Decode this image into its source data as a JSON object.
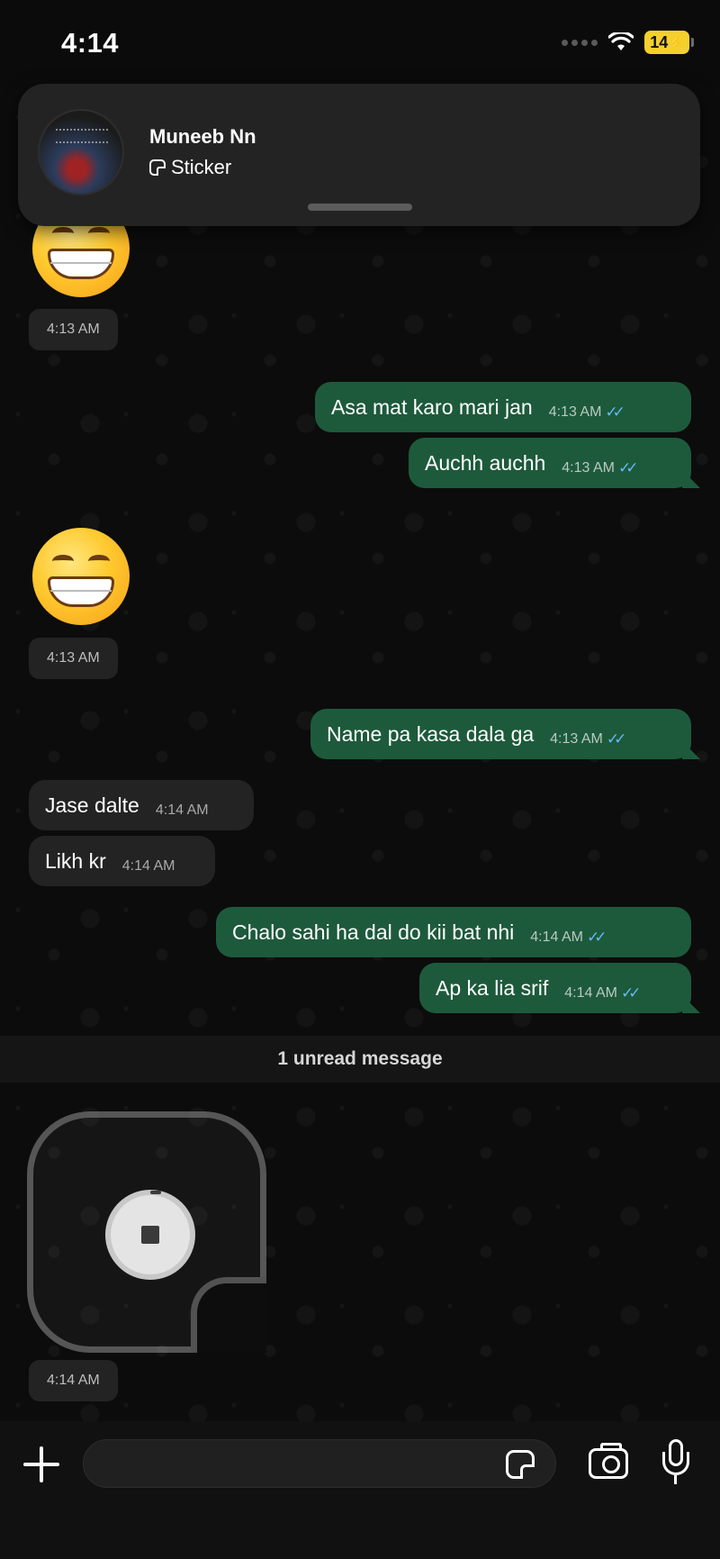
{
  "status_bar": {
    "time": "4:14",
    "battery": "14"
  },
  "notification": {
    "contact_name": "Muneeb Nn",
    "message_type": "Sticker"
  },
  "messages": [
    {
      "type": "emoji_sticker",
      "direction": "in",
      "emoji": "😁",
      "time": "4:13 AM"
    },
    {
      "type": "text",
      "direction": "out",
      "text": "Asa mat karo mari jan",
      "time": "4:13 AM",
      "read": true
    },
    {
      "type": "text",
      "direction": "out",
      "text": "Auchh auchh",
      "time": "4:13 AM",
      "read": true
    },
    {
      "type": "emoji_sticker",
      "direction": "in",
      "emoji": "😁",
      "time": "4:13 AM"
    },
    {
      "type": "text",
      "direction": "out",
      "text": "Name pa kasa dala ga",
      "time": "4:13 AM",
      "read": true
    },
    {
      "type": "text",
      "direction": "in",
      "text": "Jase dalte",
      "time": "4:14 AM"
    },
    {
      "type": "text",
      "direction": "in",
      "text": "Likh kr",
      "time": "4:14 AM"
    },
    {
      "type": "text",
      "direction": "out",
      "text": "Chalo sahi ha dal do kii bat nhi",
      "time": "4:14 AM",
      "read": true
    },
    {
      "type": "text",
      "direction": "out",
      "text": "Ap ka lia srif",
      "time": "4:14 AM",
      "read": true
    }
  ],
  "unread_divider": "1 unread message",
  "last_sticker": {
    "time": "4:14 AM",
    "state": "loading"
  },
  "input_bar": {
    "placeholder": "",
    "icons": [
      "plus-icon",
      "sticker-icon",
      "camera-icon",
      "microphone-icon"
    ]
  },
  "colors": {
    "outgoing_bubble": "#1d5a3b",
    "incoming_bubble": "#232323",
    "read_ticks": "#63b8f2",
    "battery": "#f3d02e"
  }
}
